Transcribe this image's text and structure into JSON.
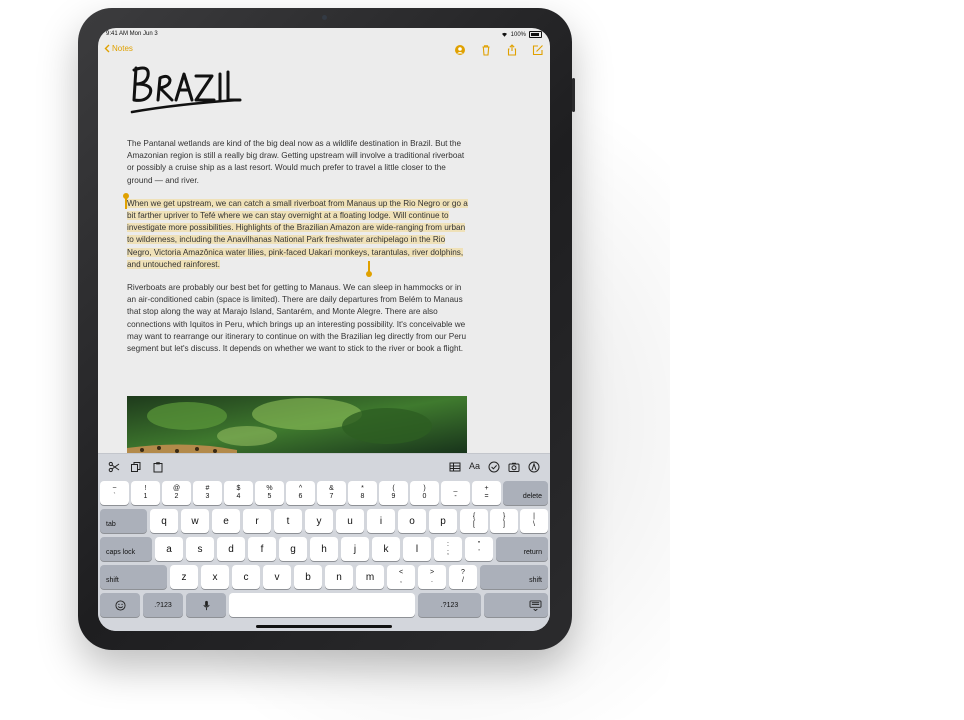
{
  "status": {
    "time": "9:41 AM  Mon Jun 3",
    "battery": "100%"
  },
  "nav": {
    "back_label": "Notes",
    "accent": "#e0a100",
    "icons": [
      "person-add-icon",
      "trash-icon",
      "share-icon",
      "compose-icon"
    ]
  },
  "note": {
    "title": "BRAZIL",
    "paragraphs": [
      "The Pantanal wetlands are kind of the big deal now as a wildlife destination in Brazil. But the Amazonian region is still a really big draw. Getting upstream will involve a traditional riverboat or possibly a cruise ship as a last resort. Would much prefer to travel a little closer to the ground — and river.",
      "When we get upstream, we can catch a small riverboat from Manaus up the Rio Negro or go a bit farther upriver to Tefé where we can stay overnight at a floating lodge. Will continue to investigate more possibilities. Highlights of the Brazilian Amazon are wide-ranging from urban to wilderness, including the Anavilhanas National Park freshwater archipelago in the Rio Negro, Victoria Amazônica water lilies, pink-faced Uakari monkeys, tarantulas, river dolphins, and untouched rainforest.",
      "Riverboats are probably our best bet for getting to Manaus. We can sleep in hammocks or in an air-conditioned cabin (space is limited). There are daily departures from Belém to Manaus that stop along the way at Marajo Island, Santarém, and Monte Alegre. There are also connections with Iquitos in Peru, which brings up an interesting possibility. It's conceivable we may want to rearrange our itinerary to continue on with the Brazilian leg directly from our Peru segment but let's discuss. It depends on whether we want to stick to the river or book a flight."
    ]
  },
  "shortcut_bar": {
    "left_icons": [
      "scissors-icon",
      "copy-icon",
      "paste-icon"
    ],
    "right": [
      "table-icon",
      "Aa",
      "checklist-icon",
      "camera-icon",
      "markup-icon"
    ]
  },
  "keyboard": {
    "number_row": [
      [
        "~",
        "`"
      ],
      [
        "!",
        "1"
      ],
      [
        "@",
        "2"
      ],
      [
        "#",
        "3"
      ],
      [
        "$",
        "4"
      ],
      [
        "%",
        "5"
      ],
      [
        "^",
        "6"
      ],
      [
        "&",
        "7"
      ],
      [
        "*",
        "8"
      ],
      [
        "(",
        "9"
      ],
      [
        ")",
        "0"
      ],
      [
        "_",
        "-"
      ],
      [
        "+",
        "="
      ]
    ],
    "delete": "delete",
    "tab": "tab",
    "row1": [
      "q",
      "w",
      "e",
      "r",
      "t",
      "y",
      "u",
      "i",
      "o",
      "p"
    ],
    "row1_extra": [
      [
        "{",
        "["
      ],
      [
        "}",
        "]"
      ],
      [
        "|",
        "\\"
      ]
    ],
    "caps": "caps lock",
    "row2": [
      "a",
      "s",
      "d",
      "f",
      "g",
      "h",
      "j",
      "k",
      "l"
    ],
    "row2_extra": [
      [
        ":",
        ";"
      ],
      [
        "\"",
        "'"
      ]
    ],
    "return": "return",
    "shift_left": "shift",
    "row3": [
      "z",
      "x",
      "c",
      "v",
      "b",
      "n",
      "m"
    ],
    "row3_extra": [
      [
        "<",
        ","
      ],
      [
        ">",
        "."
      ],
      [
        "?",
        "/"
      ]
    ],
    "shift_right": "shift",
    "bottom": {
      "emoji": "emoji-icon",
      "num_left": ".?123",
      "mic": "mic-icon",
      "num_right": ".?123",
      "hide": "keyboard-hide-icon"
    }
  }
}
